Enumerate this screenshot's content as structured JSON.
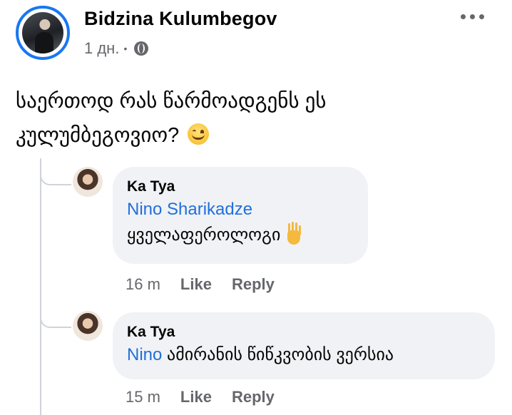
{
  "post": {
    "author": "Bidzina Kulumbegov",
    "time": "1 дн.",
    "separator": "•",
    "text_line1": "საერთოდ რას წარმოადგენს ეს",
    "text_line2": "კულუმბეგოვიო?"
  },
  "comments": [
    {
      "author": "Ka Tya",
      "tag": "Nino Sharikadze",
      "text": "ყველაფეროლოგი",
      "time": "16 m",
      "like": "Like",
      "reply": "Reply"
    },
    {
      "author": "Ka Tya",
      "tag": "Nino",
      "text": " ამირანის წიწკვობის ვერსია",
      "time": "15 m",
      "like": "Like",
      "reply": "Reply"
    }
  ],
  "icons": [
    "more-icon",
    "globe-icon",
    "smile-emoji-icon",
    "raised-hand-icon"
  ],
  "colors": {
    "accent": "#1877f2",
    "tag": "#216fdb",
    "bubble": "#f0f2f5",
    "meta": "#65676b"
  }
}
